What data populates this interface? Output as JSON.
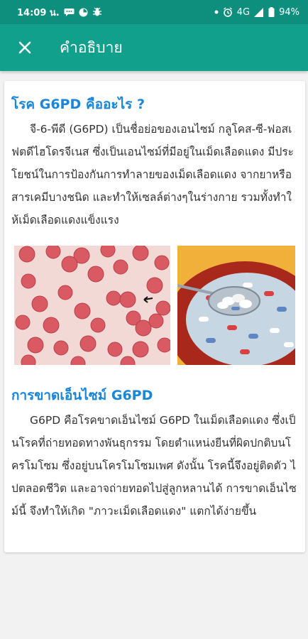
{
  "status_bar": {
    "time": "14:09 น.",
    "network": "4G",
    "battery": "94%"
  },
  "app_bar": {
    "title": "คำอธิบาย",
    "close_icon": "close-icon"
  },
  "content": {
    "section1": {
      "heading": "โรค G6PD คืออะไร ?",
      "paragraph": "จี-6-พีดี (G6PD) เป็นชื่อย่อของเอนไซม์ กลูโคส-ซี-ฟอสเฟตดีไฮโดรจีเนส ซึ่งเป็นเอนไซม์ที่มีอยู่ในเม็ดเลือดแดง มีประโยชน์ในการป้องกันการทำลายของเม็ดเลือดแดง จากยาหรือสารเคมีบางชนิด และทำให้เซลล์ต่างๆในร่างกาย รวมทั้งทำให้เม็ดเลือดแดงแข็งแรง"
    },
    "images": [
      {
        "name": "red-blood-cells-image"
      },
      {
        "name": "pills-bowl-image"
      }
    ],
    "section2": {
      "heading": "การขาดเอ็นไซม์ G6PD",
      "paragraph": "G6PD คือโรคขาดเอ็นไซม์ G6PD ในเม็ดเลือดแดง ซึ่งเป็นโรคที่ถ่ายทอดทางพันธุกรรม โดยตำแหน่งยีนที่ผิดปกติบนโครโมโซม ซึ่งอยู่บนโครโมโซมเพศ ดังนั้น โรคนี้จึงอยู่ติดตัว ไปตลอดชีวิต และอาจถ่ายทอดไปสู่ลูกหลานได้ การขาดเอ็นไซม์นี้ จึงทำให้เกิด \"ภาวะเม็ดเลือดแดง\" แตกได้ง่ายขึ้น"
    }
  },
  "colors": {
    "status_bar": "#0e8f7e",
    "app_bar": "#11a08c",
    "heading": "#1a86d8",
    "text": "#333333"
  }
}
